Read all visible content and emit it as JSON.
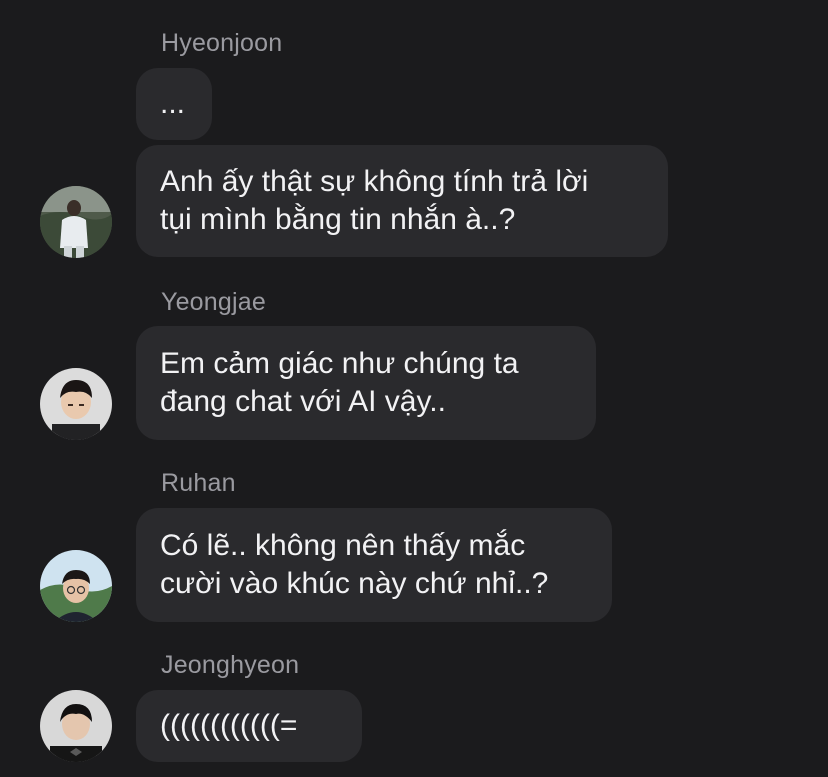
{
  "messages": [
    {
      "sender": "Hyeonjoon",
      "bubbles": [
        "...",
        "Anh ấy thật sự không tính trả lời\ntụi mình bằng tin nhắn à..?"
      ]
    },
    {
      "sender": "Yeongjae",
      "bubbles": [
        "Em cảm giác như chúng ta\nđang chat với AI vậy.."
      ]
    },
    {
      "sender": "Ruhan",
      "bubbles": [
        "Có lẽ.. không nên thấy mắc\ncười vào khúc này chứ nhỉ..?"
      ]
    },
    {
      "sender": "Jeonghyeon",
      "bubbles": [
        "((((((((((((="
      ]
    }
  ]
}
